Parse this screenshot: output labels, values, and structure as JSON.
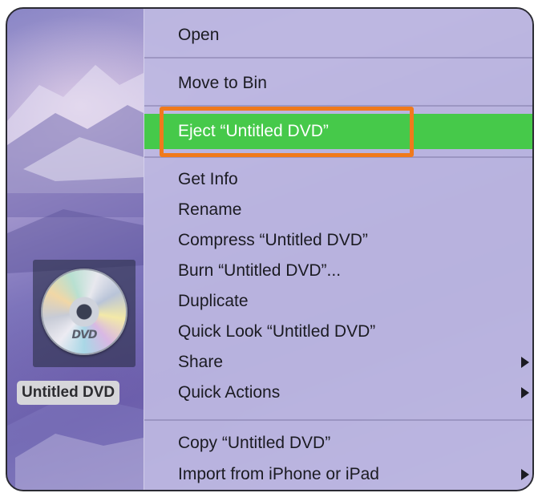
{
  "desktop": {
    "disc_logo": "DVD",
    "disc_label": "Untitled DVD"
  },
  "context_menu": {
    "items": [
      {
        "label": "Open"
      },
      {
        "label": "Move to Bin"
      },
      {
        "label": "Eject “Untitled DVD”"
      },
      {
        "label": "Get Info"
      },
      {
        "label": "Rename"
      },
      {
        "label": "Compress “Untitled DVD”"
      },
      {
        "label": "Burn “Untitled DVD”..."
      },
      {
        "label": "Duplicate"
      },
      {
        "label": "Quick Look “Untitled DVD”"
      },
      {
        "label": "Share"
      },
      {
        "label": "Quick Actions"
      },
      {
        "label": "Copy “Untitled DVD”"
      },
      {
        "label": "Import from iPhone or iPad"
      }
    ],
    "highlighted_item": "Eject “Untitled DVD”",
    "highlight_color": "#46c94a",
    "annotation_box_color": "#f07a1c"
  }
}
